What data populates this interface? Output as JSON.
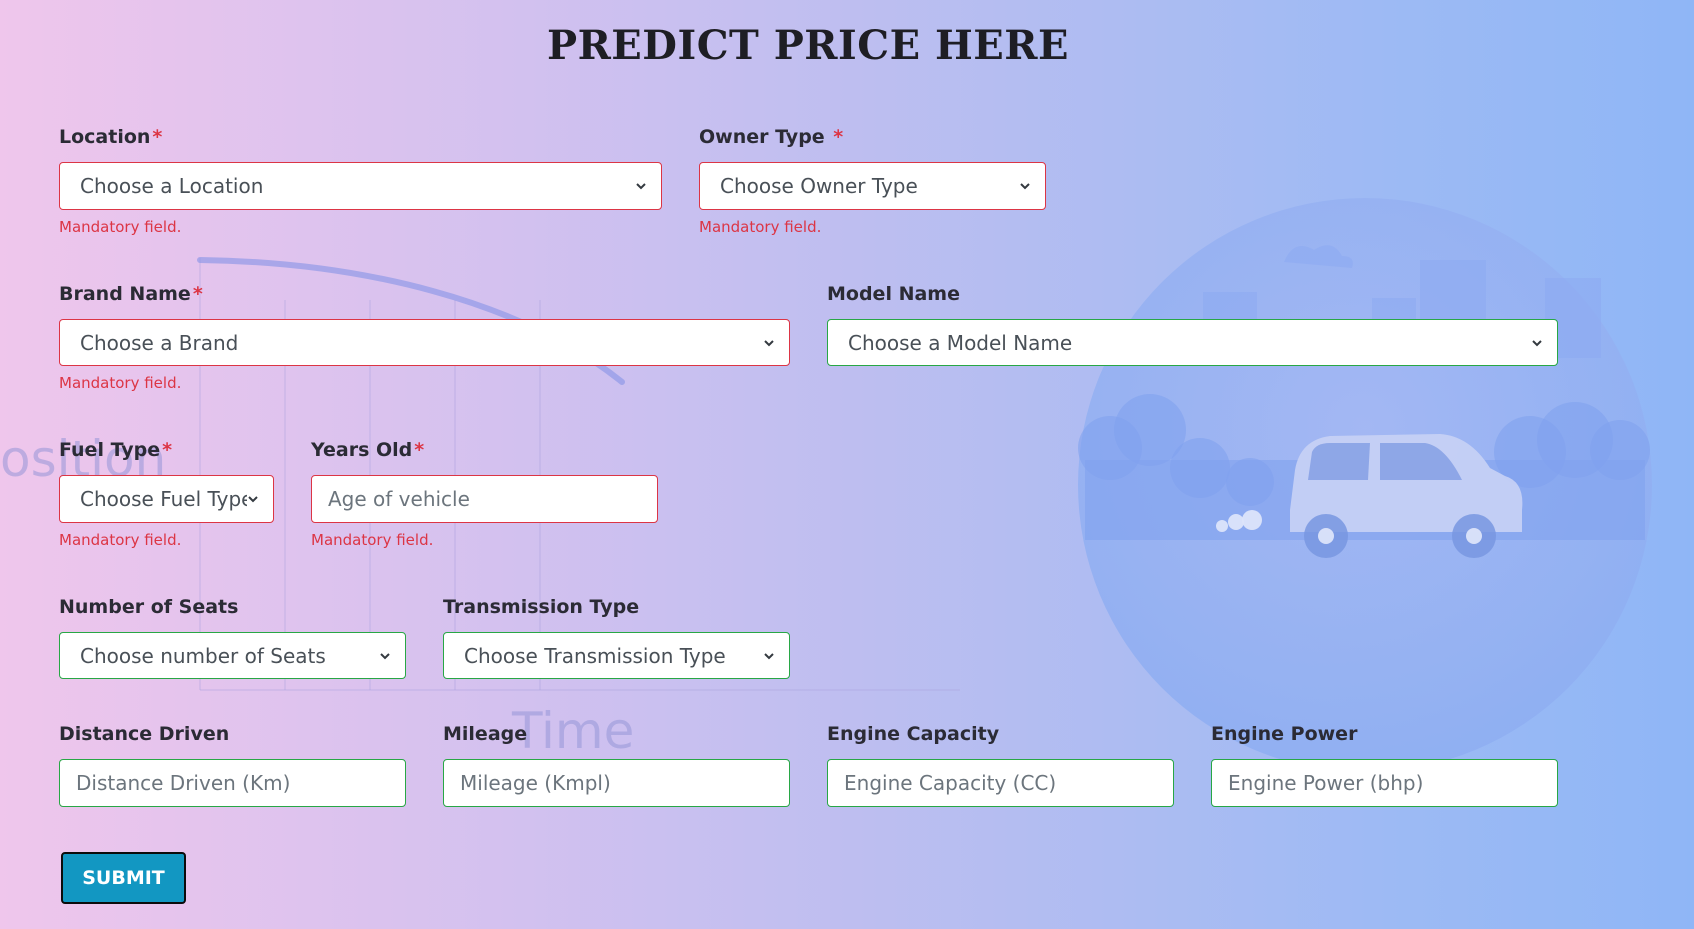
{
  "page": {
    "title": "PREDICT PRICE HERE",
    "required_marker": "*",
    "background_words": [
      "osition",
      "Time"
    ]
  },
  "colors": {
    "invalid_border": "#dc3545",
    "valid_border": "#28a745",
    "submit_bg": "#1297c2"
  },
  "form": {
    "location": {
      "label": "Location",
      "value": "Choose a Location",
      "required": true,
      "error": "Mandatory field."
    },
    "owner_type": {
      "label": "Owner Type ",
      "value": "Choose Owner Type",
      "required": true,
      "error": "Mandatory field."
    },
    "brand_name": {
      "label": "Brand Name",
      "value": "Choose a Brand",
      "required": true,
      "error": "Mandatory field."
    },
    "model_name": {
      "label": "Model Name",
      "value": "Choose a Model Name",
      "required": false
    },
    "fuel_type": {
      "label": "Fuel Type",
      "value": "Choose Fuel Type",
      "required": true,
      "error": "Mandatory field."
    },
    "years_old": {
      "label": "Years Old",
      "placeholder": "Age of vehicle",
      "value": "",
      "required": true,
      "error": "Mandatory field."
    },
    "seats": {
      "label": "Number of Seats",
      "value": "Choose number of Seats",
      "required": false
    },
    "transmission": {
      "label": "Transmission Type",
      "value": "Choose Transmission Type",
      "required": false
    },
    "distance": {
      "label": "Distance Driven",
      "placeholder": "Distance Driven (Km)",
      "value": ""
    },
    "mileage": {
      "label": "Mileage",
      "placeholder": "Mileage (Kmpl)",
      "value": ""
    },
    "engine_capacity": {
      "label": "Engine Capacity",
      "placeholder": "Engine Capacity (CC)",
      "value": ""
    },
    "engine_power": {
      "label": "Engine Power",
      "placeholder": "Engine Power (bhp)",
      "value": ""
    },
    "submit_label": "SUBMIT"
  }
}
